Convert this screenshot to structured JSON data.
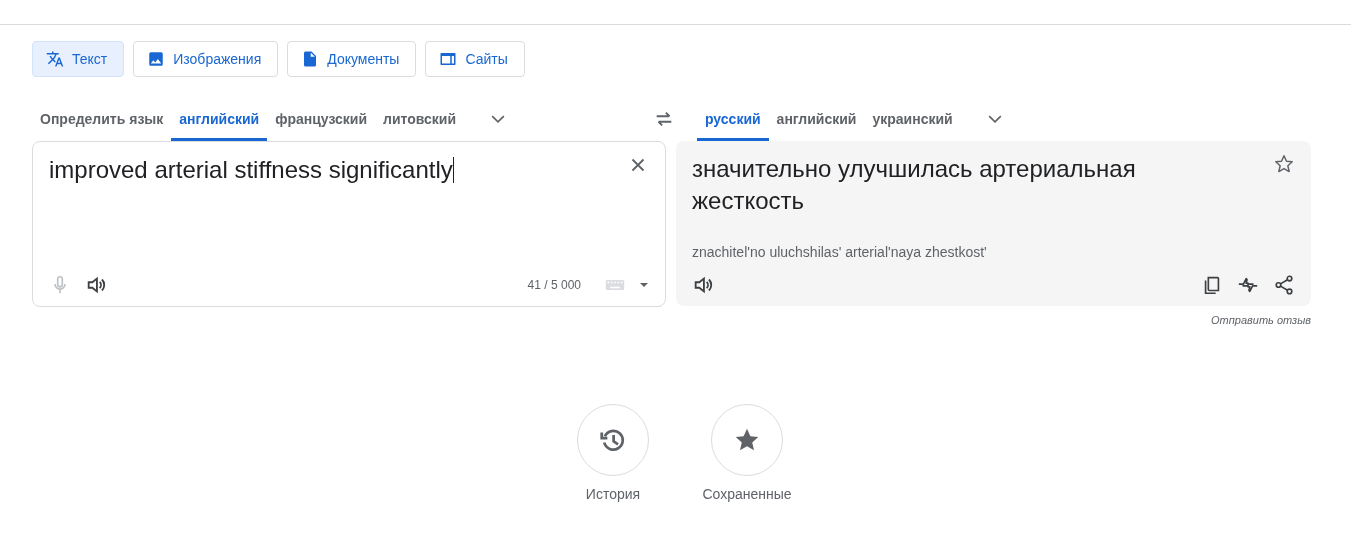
{
  "modes": [
    {
      "kind": "text",
      "label": "Текст",
      "selected": true
    },
    {
      "kind": "image",
      "label": "Изображения",
      "selected": false
    },
    {
      "kind": "document",
      "label": "Документы",
      "selected": false
    },
    {
      "kind": "site",
      "label": "Сайты",
      "selected": false
    }
  ],
  "source_languages": [
    {
      "label": "Определить язык",
      "selected": false
    },
    {
      "label": "английский",
      "selected": true
    },
    {
      "label": "французский",
      "selected": false
    },
    {
      "label": "литовский",
      "selected": false
    }
  ],
  "target_languages": [
    {
      "label": "русский",
      "selected": true
    },
    {
      "label": "английский",
      "selected": false
    },
    {
      "label": "украинский",
      "selected": false
    }
  ],
  "source": {
    "value": "improved arterial stiffness significantly",
    "char_count": "41 / 5 000"
  },
  "target": {
    "translation": "значительно улучшилась артериальная жесткость",
    "transliteration": "znachitel'no uluchshilas' arterial'naya zhestkost'",
    "feedback_link": "Отправить отзыв"
  },
  "shortcuts": [
    {
      "kind": "history",
      "label": "История"
    },
    {
      "kind": "saved",
      "label": "Сохраненные"
    }
  ]
}
